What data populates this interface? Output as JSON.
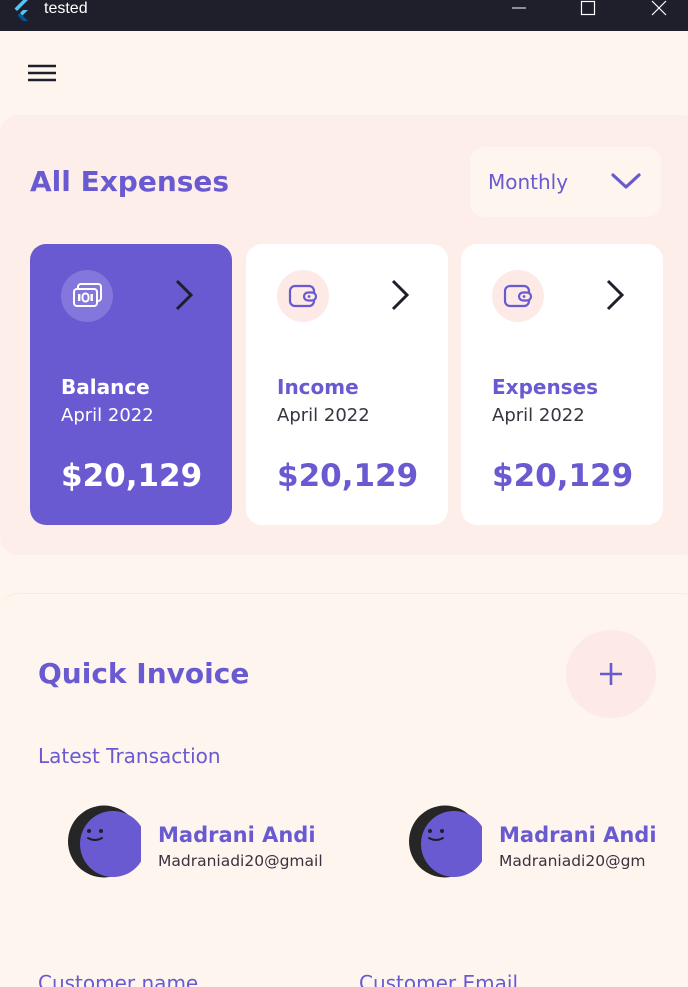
{
  "window": {
    "title": "tested",
    "logo_icon": "flutter-logo-icon",
    "controls": [
      "minimize-icon",
      "maximize-icon",
      "close-icon"
    ]
  },
  "toolbar": {
    "menu_icon": "hamburger-menu-icon"
  },
  "expenses": {
    "title": "All Expenses",
    "period_dropdown": {
      "selected": "Monthly",
      "icon": "chevron-down-icon"
    },
    "cards": [
      {
        "label": "Balance",
        "date": "April 2022",
        "amount": "$20,129",
        "icon": "money-icon",
        "active": true
      },
      {
        "label": "Income",
        "date": "April 2022",
        "amount": "$20,129",
        "icon": "wallet-icon",
        "active": false
      },
      {
        "label": "Expenses",
        "date": "April 2022",
        "amount": "$20,129",
        "icon": "wallet-icon",
        "active": false
      }
    ]
  },
  "invoice": {
    "title": "Quick Invoice",
    "add_icon": "plus-icon",
    "latest_label": "Latest Transaction",
    "contacts": [
      {
        "name": "Madrani Andi",
        "email": "Madraniadi20@gmail"
      },
      {
        "name": "Madrani Andi",
        "email": "Madraniadi20@gm"
      }
    ],
    "fields": {
      "customer_name": "Customer name",
      "customer_email": "Customer Email"
    }
  },
  "colors": {
    "accent": "#6a5ad1",
    "titlebar": "#1f1f2b",
    "background": "#fdf5ee",
    "panel": "#fdeee9",
    "icon_bg": "#fde9e5"
  }
}
